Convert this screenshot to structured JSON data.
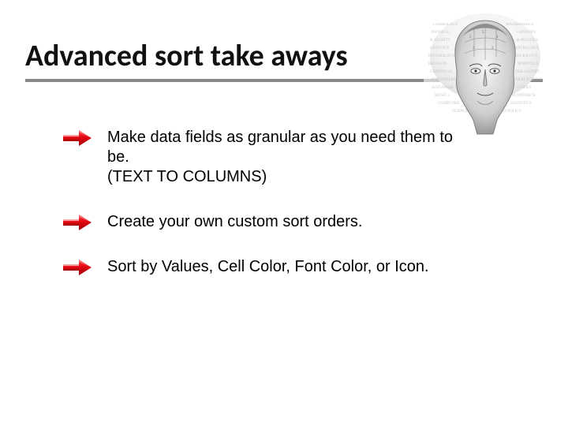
{
  "title": "Advanced sort take aways",
  "bullets": [
    "Make data fields as granular as you need them to be.\n(TEXT TO COLUMNS)",
    "Create your own custom sort orders.",
    "Sort by Values, Cell Color, Font Color, or Icon."
  ],
  "colors": {
    "arrow_body": "#e20613",
    "arrow_highlight": "#ffffff",
    "rule": "#888888"
  }
}
